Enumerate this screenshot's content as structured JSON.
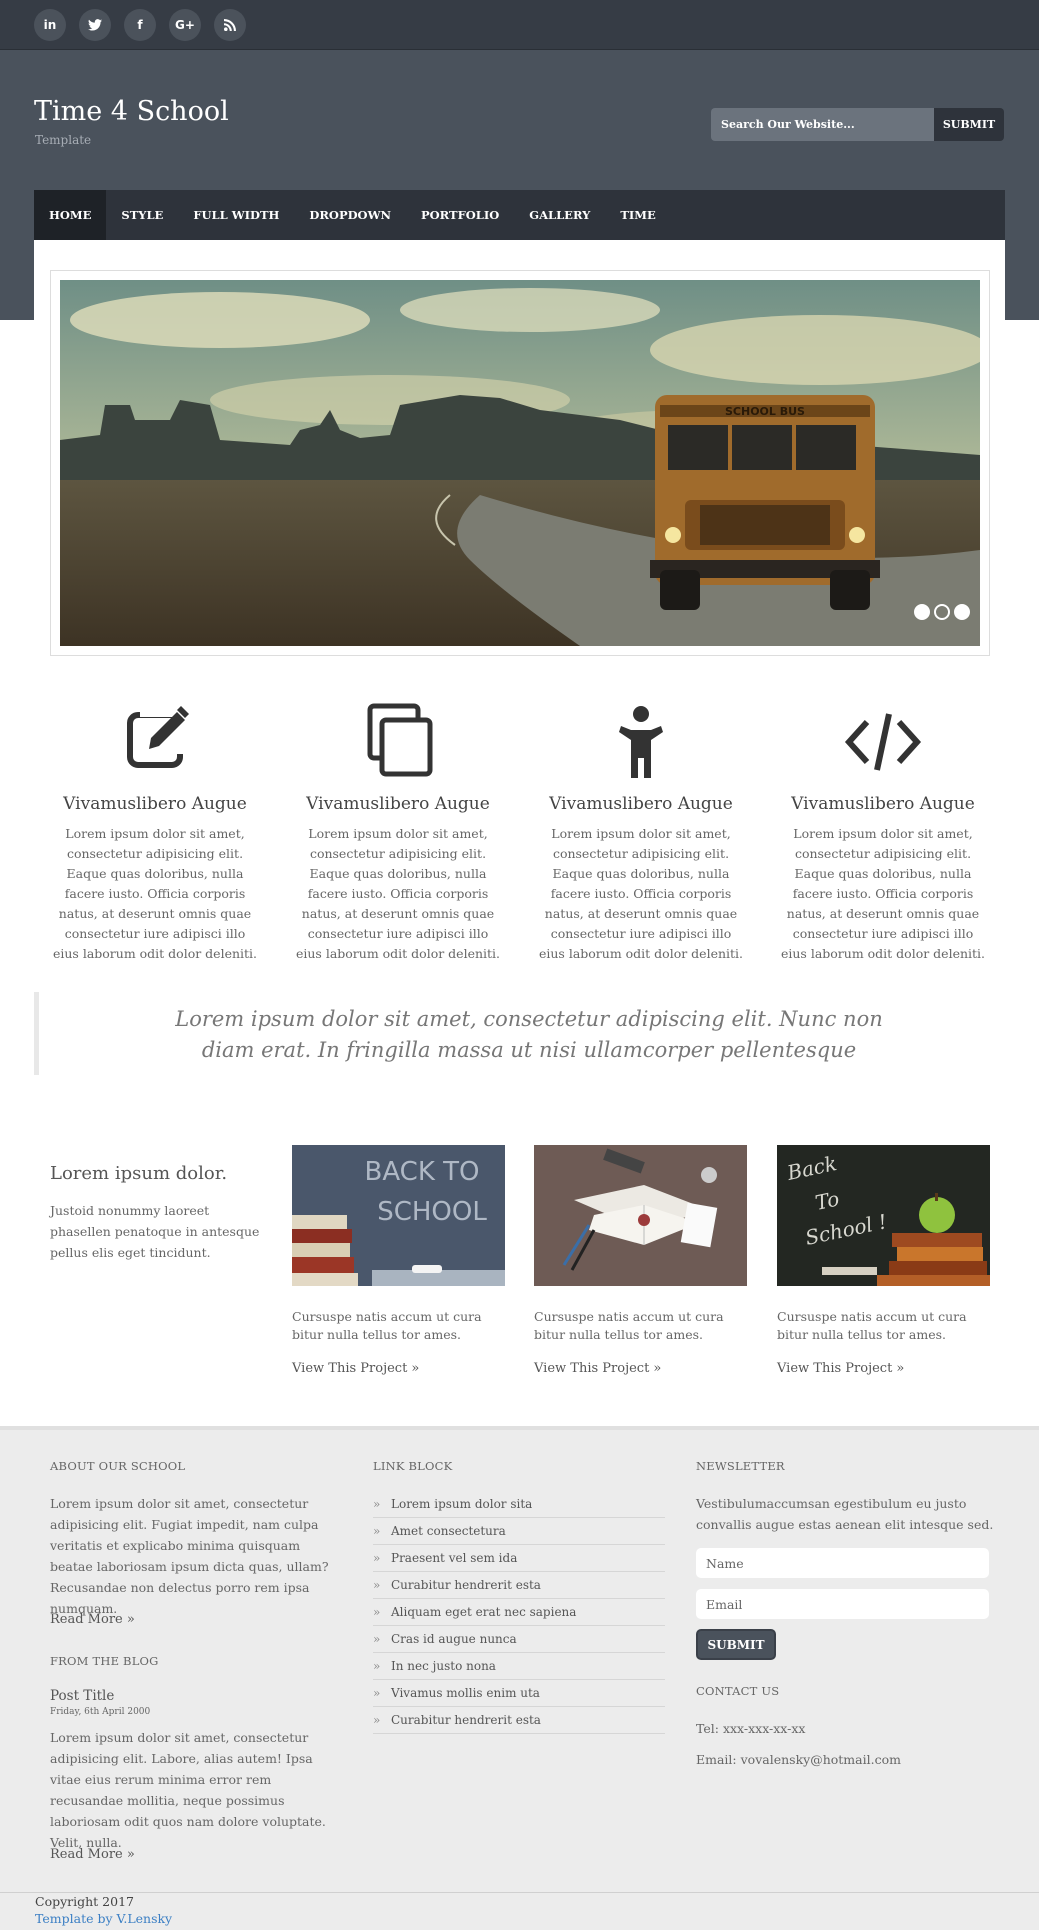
{
  "social": [
    "in",
    "t",
    "f",
    "G+",
    "rss"
  ],
  "site": {
    "title": "Time 4 School",
    "subtitle": "Template"
  },
  "search": {
    "placeholder": "Search Our Website...",
    "button": "SUBMIT"
  },
  "nav": [
    "HOME",
    "STYLE",
    "FULL WIDTH",
    "DROPDOWN",
    "PORTFOLIO",
    "GALLERY",
    "TIME"
  ],
  "slider": {
    "active_dot": 2,
    "dot_count": 3
  },
  "features": [
    {
      "icon": "edit-icon",
      "title": "Vivamuslibero Augue",
      "text": "Lorem ipsum dolor sit amet, consectetur adipisicing elit. Eaque quas doloribus, nulla facere iusto. Officia corporis natus, at deserunt omnis quae consectetur iure adipisci illo eius laborum odit dolor deleniti."
    },
    {
      "icon": "copy-icon",
      "title": "Vivamuslibero Augue",
      "text": "Lorem ipsum dolor sit amet, consectetur adipisicing elit. Eaque quas doloribus, nulla facere iusto. Officia corporis natus, at deserunt omnis quae consectetur iure adipisci illo eius laborum odit dolor deleniti."
    },
    {
      "icon": "child-icon",
      "title": "Vivamuslibero Augue",
      "text": "Lorem ipsum dolor sit amet, consectetur adipisicing elit. Eaque quas doloribus, nulla facere iusto. Officia corporis natus, at deserunt omnis quae consectetur iure adipisci illo eius laborum odit dolor deleniti."
    },
    {
      "icon": "code-icon",
      "title": "Vivamuslibero Augue",
      "text": "Lorem ipsum dolor sit amet, consectetur adipisicing elit. Eaque quas doloribus, nulla facere iusto. Officia corporis natus, at deserunt omnis quae consectetur iure adipisci illo eius laborum odit dolor deleniti."
    }
  ],
  "quote": "Lorem ipsum dolor sit amet, consectetur adipiscing elit. Nunc non diam erat. In fringilla massa ut nisi ullamcorper pellentesque",
  "projects": {
    "title": "Lorem ipsum dolor.",
    "text": "Justoid nonummy laoreet phasellen penatoque in antesque pellus elis eget tincidunt.",
    "items": [
      {
        "image": "back-to-school-books",
        "text": "Cursuspe natis accum ut cura bitur nulla tellus tor ames.",
        "link": "View This Project"
      },
      {
        "image": "school-supplies-desk",
        "text": "Cursuspe natis accum ut cura bitur nulla tellus tor ames.",
        "link": "View This Project"
      },
      {
        "image": "back-to-school-chalkboard-apple",
        "text": "Cursuspe natis accum ut cura bitur nulla tellus tor ames.",
        "link": "View This Project"
      }
    ]
  },
  "footer": {
    "about_heading": "ABOUT OUR SCHOOL",
    "about_text": "Lorem ipsum dolor sit amet, consectetur adipisicing elit. Fugiat impedit, nam culpa veritatis et explicabo minima quisquam beatae laboriosam ipsum dicta quas, ullam? Recusandae non delectus porro rem ipsa numquam.",
    "read_more": "Read More",
    "blog_heading": "FROM THE BLOG",
    "post_title": "Post Title",
    "post_date": "Friday, 6th April 2000",
    "post_text": "Lorem ipsum dolor sit amet, consectetur adipisicing elit. Labore, alias autem! Ipsa vitae eius rerum minima error rem recusandae mollitia, neque possimus laboriosam odit quos nam dolore voluptate. Velit, nulla.",
    "read_more_2": "Read More",
    "links_heading": "LINK BLOCK",
    "links": [
      "Lorem ipsum dolor sita",
      "Amet consectetura",
      "Praesent vel sem ida",
      "Curabitur hendrerit esta",
      "Aliquam eget erat nec sapiena",
      "Cras id augue nunca",
      "In nec justo nona",
      "Vivamus mollis enim uta",
      "Curabitur hendrerit esta"
    ],
    "newsletter_heading": "NEWSLETTER",
    "newsletter_text": "Vestibulumaccumsan egestibulum eu justo convallis augue estas aenean elit intesque sed.",
    "name_placeholder": "Name",
    "email_placeholder": "Email",
    "submit": "SUBMIT",
    "contact_heading": "CONTACT US",
    "tel": "Tel: xxx-xxx-xx-xx",
    "email": "Email: vovalensky@hotmail.com"
  },
  "copyright": "Copyright 2017",
  "credit": "Template by V.Lensky",
  "colors": {
    "header": "#4a525c",
    "topbar": "#363c45",
    "nav": "#2e333b",
    "footer": "#ececec",
    "link": "#3b7fc4"
  }
}
